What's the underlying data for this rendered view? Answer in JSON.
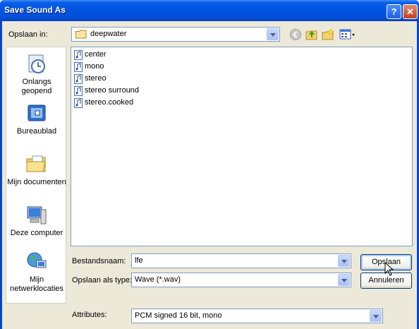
{
  "window": {
    "title": "Save Sound As"
  },
  "title_buttons": {
    "help": "?",
    "close": "✕"
  },
  "save_in": {
    "label": "Opslaan in:",
    "value": "deepwater"
  },
  "toolbar_icons": [
    "back-icon",
    "up-folder-icon",
    "new-folder-icon",
    "view-menu-icon"
  ],
  "places": [
    {
      "label": "Onlangs geopend",
      "icon": "recent-icon"
    },
    {
      "label": "Bureaublad",
      "icon": "desktop-icon"
    },
    {
      "label": "Mijn documenten",
      "icon": "my-documents-icon"
    },
    {
      "label": "Deze computer",
      "icon": "my-computer-icon"
    },
    {
      "label": "Mijn netwerklocaties",
      "icon": "network-icon"
    }
  ],
  "files": [
    {
      "name": "center"
    },
    {
      "name": "mono"
    },
    {
      "name": "stereo"
    },
    {
      "name": "stereo surround"
    },
    {
      "name": "stereo.cooked"
    }
  ],
  "filename": {
    "label": "Bestandsnaam:",
    "value": "lfe"
  },
  "filetype": {
    "label": "Opslaan als type:",
    "value": "Wave (*.wav)"
  },
  "attributes": {
    "label": "Attributes:",
    "value": "PCM signed 16 bit, mono"
  },
  "buttons": {
    "save": "Opslaan",
    "cancel": "Annuleren"
  },
  "colors": {
    "titlebar": "#0054e3",
    "dialog_bg": "#ece9d8",
    "close": "#c3411b"
  }
}
